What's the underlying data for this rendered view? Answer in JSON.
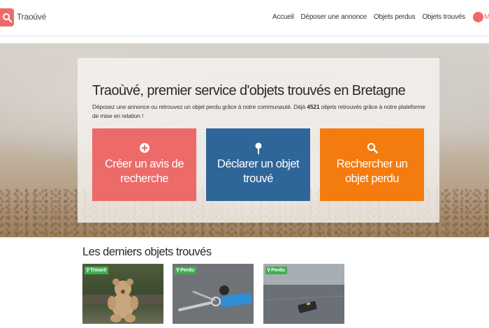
{
  "brand": {
    "name": "Traoùvé"
  },
  "nav": {
    "items": [
      "Accueil",
      "Déposer une annonce",
      "Objets perdus",
      "Objets trouvés"
    ],
    "user_initial": "M"
  },
  "hero": {
    "title": "Traoùvé, premier service d'objets trouvés en Bretagne",
    "desc_before": "Déposez une annonce ou retrouvez un objet perdu grâce à notre communauté. Déjà ",
    "count": "4521",
    "desc_after": " objets retrouvés grâce à notre plateforme de mise en relation !"
  },
  "cta": [
    {
      "label": "Créer un avis de recherche",
      "icon": "plus-circle-icon",
      "color": "#ec6a68"
    },
    {
      "label": "Déclarer un objet trouvé",
      "icon": "pin-icon",
      "color": "#2f6699"
    },
    {
      "label": "Rechercher un objet perdu",
      "icon": "search-icon",
      "color": "#f47b0e"
    }
  ],
  "section": {
    "title": "Les derniers objets trouvés"
  },
  "items": [
    {
      "status": "Trouvé",
      "image": "teddy-bear-photo"
    },
    {
      "status": "Perdu",
      "image": "keys-photo"
    },
    {
      "status": "Perdu",
      "image": "wallet-on-road-photo"
    }
  ],
  "colors": {
    "accent": "#ee6a6a",
    "badge": "#3fae4e"
  }
}
